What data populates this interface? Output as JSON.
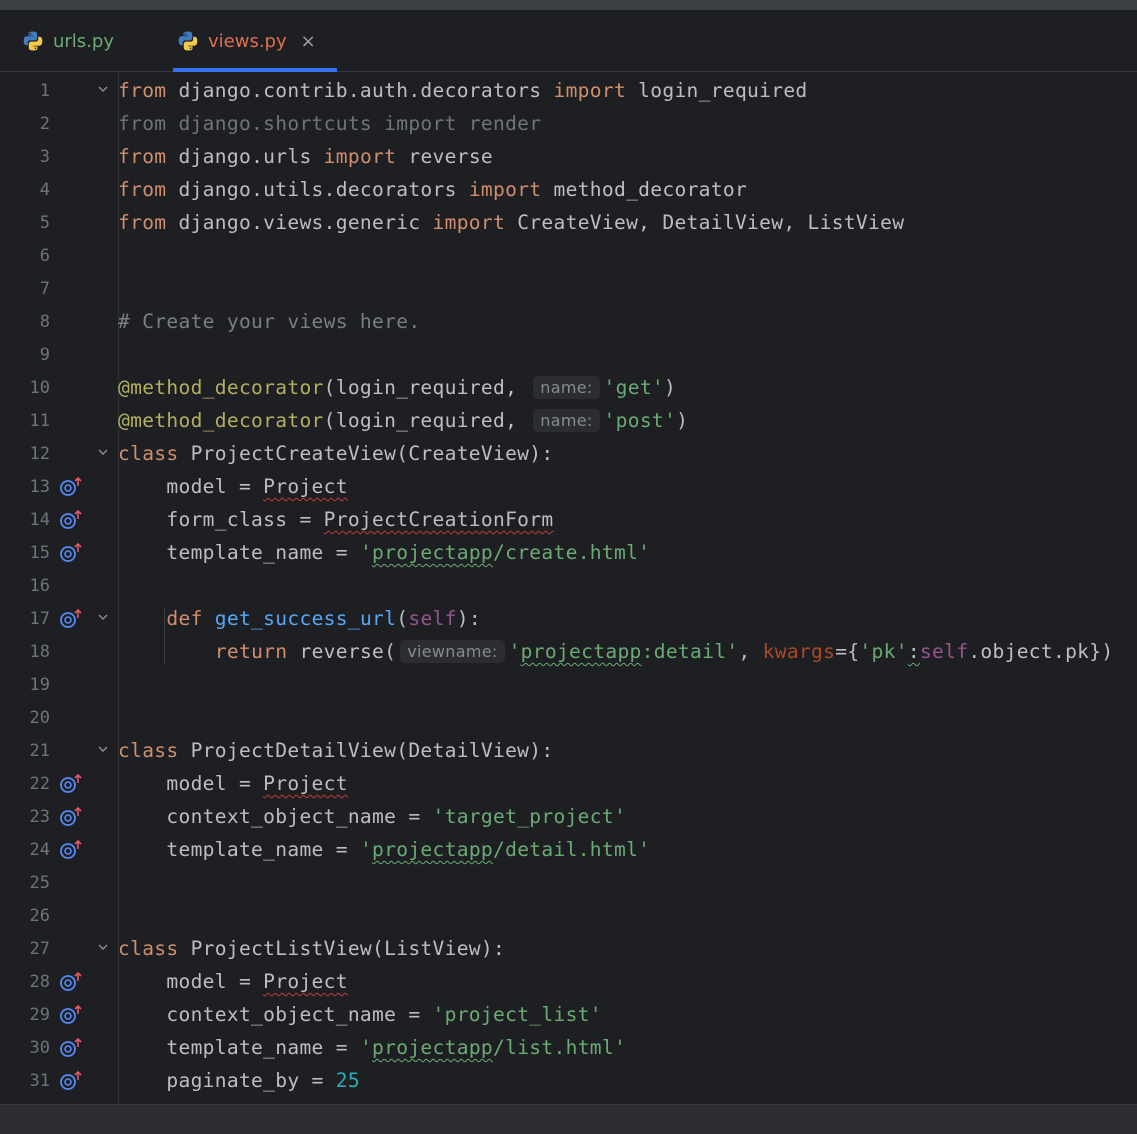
{
  "tabs": [
    {
      "label": "urls.py",
      "active": false
    },
    {
      "label": "views.py",
      "active": true
    }
  ],
  "close_symbol": "×",
  "gutter_icon": "override-method-icon",
  "colors": {
    "keyword": "#cf8e6d",
    "string": "#6aab73",
    "function": "#56a8f5",
    "decorator": "#b3ae60",
    "self": "#94558d",
    "number": "#2aacb8",
    "text": "#bcbec4"
  },
  "lines": [
    {
      "n": "1"
    },
    {
      "n": "2"
    },
    {
      "n": "3"
    },
    {
      "n": "4"
    },
    {
      "n": "5"
    },
    {
      "n": "6"
    },
    {
      "n": "7"
    },
    {
      "n": "8"
    },
    {
      "n": "9"
    },
    {
      "n": "10"
    },
    {
      "n": "11"
    },
    {
      "n": "12"
    },
    {
      "n": "13"
    },
    {
      "n": "14"
    },
    {
      "n": "15"
    },
    {
      "n": "16"
    },
    {
      "n": "17"
    },
    {
      "n": "18"
    },
    {
      "n": "19"
    },
    {
      "n": "20"
    },
    {
      "n": "21"
    },
    {
      "n": "22"
    },
    {
      "n": "23"
    },
    {
      "n": "24"
    },
    {
      "n": "25"
    },
    {
      "n": "26"
    },
    {
      "n": "27"
    },
    {
      "n": "28"
    },
    {
      "n": "29"
    },
    {
      "n": "30"
    },
    {
      "n": "31"
    }
  ],
  "code": {
    "l1": [
      "from",
      " django.contrib.auth.decorators ",
      "import",
      " login_required"
    ],
    "l2": "from django.shortcuts import render",
    "l3": [
      "from",
      " django.urls ",
      "import",
      " reverse"
    ],
    "l4": [
      "from",
      " django.utils.decorators ",
      "import",
      " method_decorator"
    ],
    "l5": [
      "from",
      " django.views.generic ",
      "import",
      " CreateView, DetailView, ListView"
    ],
    "l8": "# Create your views here.",
    "l10": [
      "@method_decorator",
      "(login_required, ",
      "name:",
      "'get'",
      ")"
    ],
    "l11": [
      "@method_decorator",
      "(login_required, ",
      "name:",
      "'post'",
      ")"
    ],
    "l12": [
      "class",
      " ProjectCreateView(CreateView):"
    ],
    "l13": [
      "    model = ",
      "Project"
    ],
    "l14": [
      "    form_class = ",
      "ProjectCreationForm"
    ],
    "l15": [
      "    template_name = ",
      "'",
      "projectapp",
      "/create.html'"
    ],
    "l17": [
      "    ",
      "def",
      " ",
      "get_success_url",
      "(",
      "self",
      "):"
    ],
    "l18": [
      "        ",
      "return",
      " reverse(",
      "viewname:",
      "'",
      "projectapp",
      ":detail'",
      ", ",
      "kwargs",
      "={",
      "'pk'",
      ":",
      "self",
      ".object.pk})"
    ],
    "l21": [
      "class",
      " ProjectDetailView(DetailView):"
    ],
    "l22": [
      "    model = ",
      "Project"
    ],
    "l23": [
      "    context_object_name = ",
      "'target_project'"
    ],
    "l24": [
      "    template_name = ",
      "'",
      "projectapp",
      "/detail.html'"
    ],
    "l27": [
      "class",
      " ProjectListView(ListView):"
    ],
    "l28": [
      "    model = ",
      "Project"
    ],
    "l29": [
      "    context_object_name = ",
      "'project_list'"
    ],
    "l30": [
      "    template_name = ",
      "'",
      "projectapp",
      "/list.html'"
    ],
    "l31": [
      "    paginate_by = ",
      "25"
    ]
  }
}
